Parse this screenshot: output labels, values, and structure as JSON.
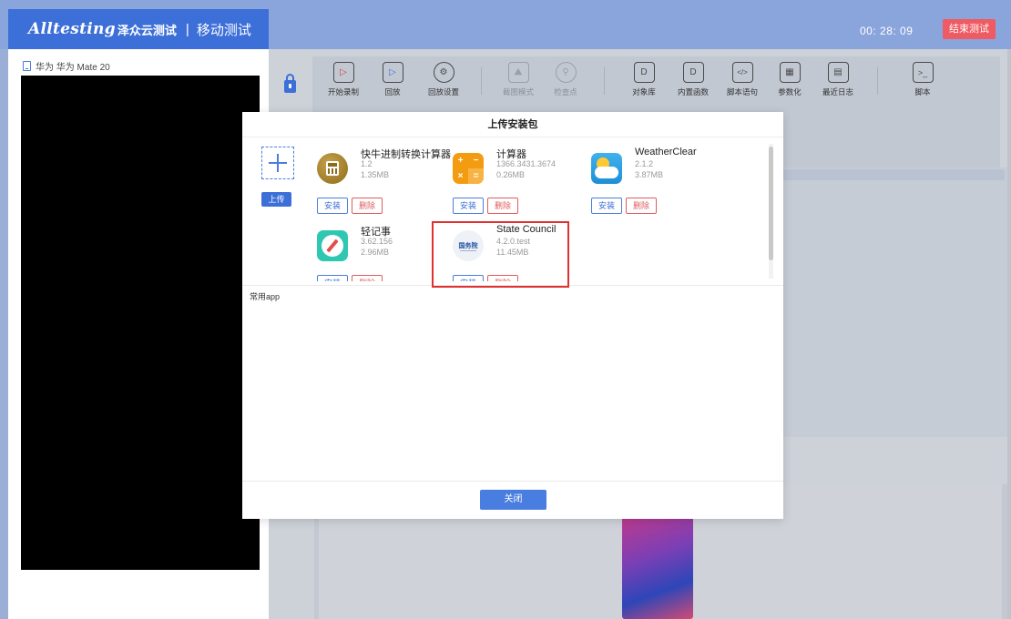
{
  "header": {
    "logo": "Alltesting",
    "brand": "泽众云测试",
    "separator": "|",
    "title": "移动测试",
    "timer": "00:  28:  09",
    "end_button": "结束测试"
  },
  "device": {
    "label": "华为 华为 Mate 20"
  },
  "toolbar": {
    "items": [
      {
        "label": "开始录制",
        "icon": "record-icon"
      },
      {
        "label": "回放",
        "icon": "playback-icon"
      },
      {
        "label": "回放设置",
        "icon": "gear-icon"
      },
      {
        "label": "截图模式",
        "icon": "image-icon"
      },
      {
        "label": "检查点",
        "icon": "checkpoint-icon"
      },
      {
        "label": "对象库",
        "icon": "document-icon"
      },
      {
        "label": "内置函数",
        "icon": "document-icon"
      },
      {
        "label": "脚本语句",
        "icon": "code-icon"
      },
      {
        "label": "参数化",
        "icon": "grid-icon"
      },
      {
        "label": "最近日志",
        "icon": "calendar-icon"
      },
      {
        "label": "脚本",
        "icon": "terminal-icon"
      }
    ]
  },
  "modal": {
    "title": "上传安装包",
    "upload_label": "上传",
    "install_label": "安装",
    "delete_label": "删除",
    "apps": [
      {
        "name": "快牛进制转换计算器",
        "version": "1.2",
        "size": "1.35MB",
        "icon": "calculator-gold-icon"
      },
      {
        "name": "计算器",
        "version": "1366.3431.3674",
        "size": "0.26MB",
        "icon": "calculator-orange-icon"
      },
      {
        "name": "WeatherClear",
        "version": "2.1.2",
        "size": "3.87MB",
        "icon": "weather-icon"
      },
      {
        "name": "轻记事",
        "version": "3.62.156",
        "size": "2.96MB",
        "icon": "notes-icon"
      },
      {
        "name": "State Council",
        "version": "4.2.0.test",
        "size": "11.45MB",
        "icon": "state-council-icon"
      }
    ],
    "section_label": "常用app",
    "close_label": "关闭"
  },
  "colors": {
    "primary": "#3d6fd8",
    "danger": "#e15d5d",
    "highlight": "#e03030",
    "end_button": "#ee5b62"
  }
}
